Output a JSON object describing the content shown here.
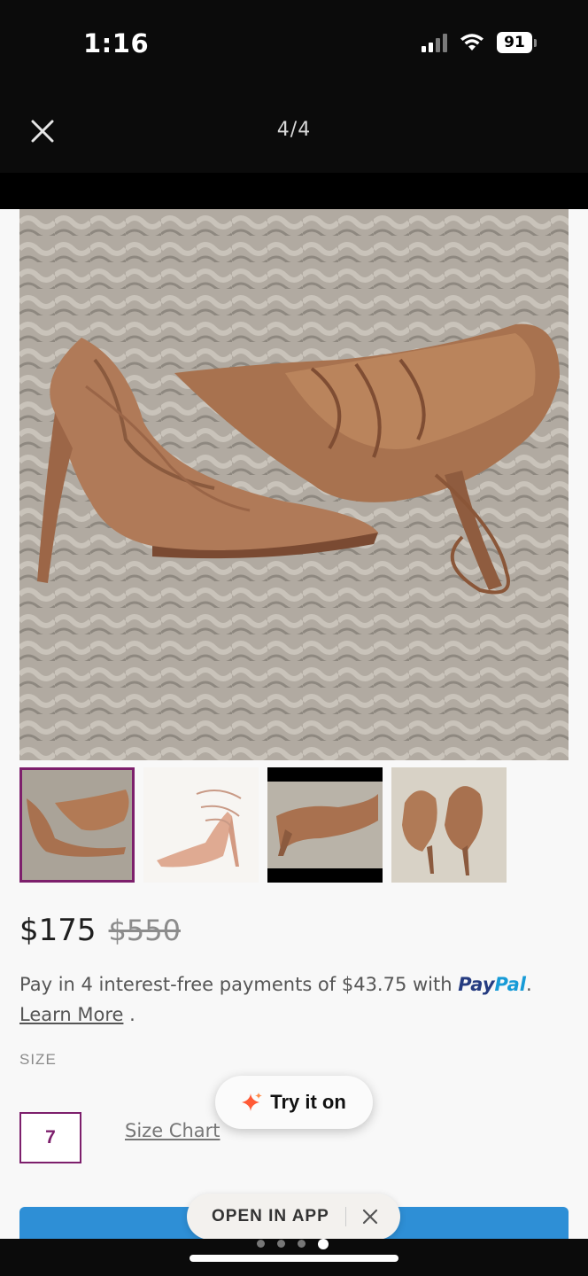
{
  "status_bar": {
    "time": "1:16",
    "battery": "91"
  },
  "nav": {
    "counter": "4/4"
  },
  "product": {
    "price": "$175",
    "original_price": "$550",
    "pay_text": "Pay in 4 interest-free payments of $43.75 with",
    "paypal_part1": "Pay",
    "paypal_part2": "Pal",
    "paypal_suffix": ".",
    "learn_more": "Learn More",
    "learn_more_suffix": " .",
    "size_label": "SIZE",
    "selected_size": "7",
    "size_chart": "Size Chart"
  },
  "try_on": {
    "label": "Try it on"
  },
  "open_app": {
    "label": "OPEN IN APP"
  },
  "gallery": {
    "selected_index": 0,
    "page_dots": 4,
    "active_dot": 3
  },
  "colors": {
    "accent": "#7d1f6c",
    "buy_button": "#2e8fd6",
    "paypal_dark": "#253b80",
    "paypal_light": "#179bd7"
  }
}
